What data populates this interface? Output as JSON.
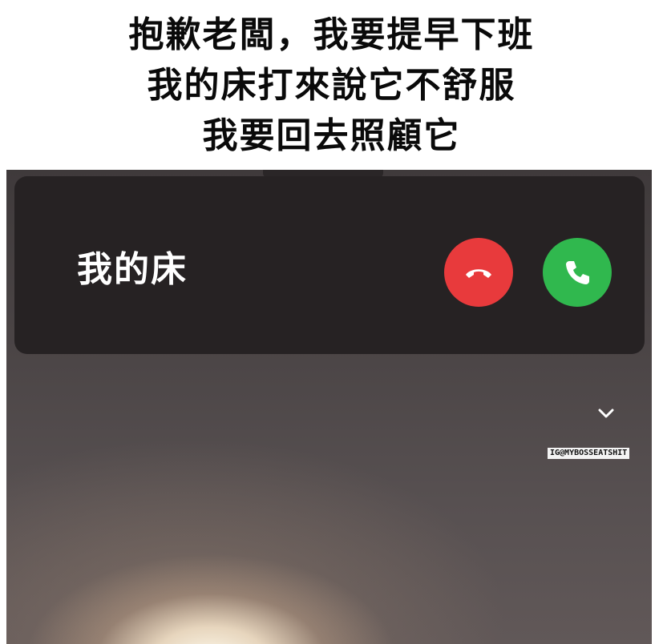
{
  "caption": {
    "lines": [
      "抱歉老闆，我要提早下班",
      "我的床打來說它不舒服",
      "我要回去照顧它"
    ]
  },
  "call": {
    "caller_name": "我的床",
    "decline_icon": "phone-hangup-icon",
    "accept_icon": "phone-icon",
    "decline_color": "#e83a3c",
    "accept_color": "#30b84e",
    "collapse_icon": "chevron-down-icon"
  },
  "watermark": "IG@MYBOSSEATSHIT"
}
